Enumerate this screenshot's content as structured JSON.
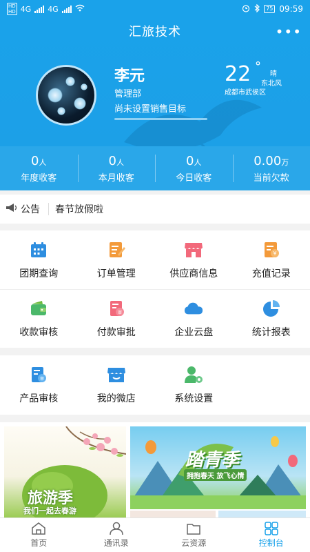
{
  "status": {
    "network": "4G",
    "battery": "75",
    "time": "09:59"
  },
  "header": {
    "title": "汇旅技术",
    "more": "•••"
  },
  "profile": {
    "name": "李元",
    "department": "管理部",
    "goal_text": "尚未设置销售目标"
  },
  "weather": {
    "temperature": "22",
    "degree": "°",
    "condition": "晴",
    "wind": "东北风",
    "location": "成都市武侯区"
  },
  "stats": [
    {
      "value": "0",
      "unit": "人",
      "label": "年度收客"
    },
    {
      "value": "0",
      "unit": "人",
      "label": "本月收客"
    },
    {
      "value": "0",
      "unit": "人",
      "label": "今日收客"
    },
    {
      "value": "0.00",
      "unit": "万",
      "label": "当前欠款"
    }
  ],
  "notice": {
    "tag": "公告",
    "message": "春节放假啦"
  },
  "menu": {
    "row1": [
      "团期查询",
      "订单管理",
      "供应商信息",
      "充值记录"
    ],
    "row2": [
      "收款审核",
      "付款审批",
      "企业云盘",
      "统计报表"
    ],
    "row3": [
      "产品审核",
      "我的微店",
      "系统设置"
    ]
  },
  "banners": {
    "left_title": "旅游季",
    "left_sub": "我们一起去春游",
    "right_title": "踏青季",
    "right_sub": "拥抱春天  放飞心情"
  },
  "tabs": [
    "首页",
    "通讯录",
    "云资源",
    "控制台"
  ],
  "colors": {
    "primary": "#1aa2ea",
    "orange": "#f39a3a",
    "pink": "#f2697b",
    "green": "#4bb86a",
    "blue": "#2e8ee0"
  }
}
